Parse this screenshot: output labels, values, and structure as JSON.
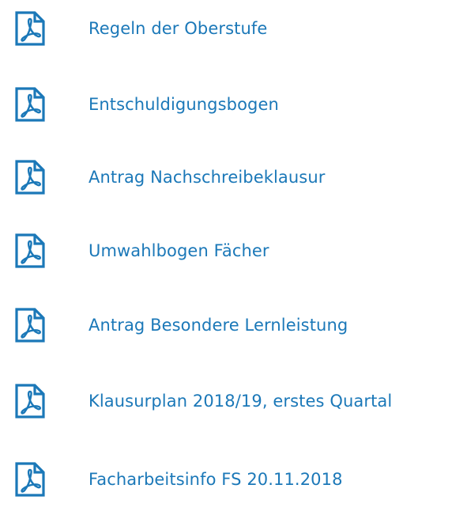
{
  "colors": {
    "accent": "#1b78b8"
  },
  "documents": [
    {
      "icon": "pdf-file-icon",
      "label": "Regeln der Oberstufe"
    },
    {
      "icon": "pdf-file-icon",
      "label": "Entschuldigungsbogen"
    },
    {
      "icon": "pdf-file-icon",
      "label": "Antrag Nachschreibeklausur"
    },
    {
      "icon": "pdf-file-icon",
      "label": "Umwahlbogen Fächer"
    },
    {
      "icon": "pdf-file-icon",
      "label": "Antrag Besondere Lernleistung"
    },
    {
      "icon": "pdf-file-icon",
      "label": "Klausurplan 2018/19, erstes Quartal"
    },
    {
      "icon": "pdf-file-icon",
      "label": "Facharbeitsinfo FS 20.11.2018"
    }
  ]
}
